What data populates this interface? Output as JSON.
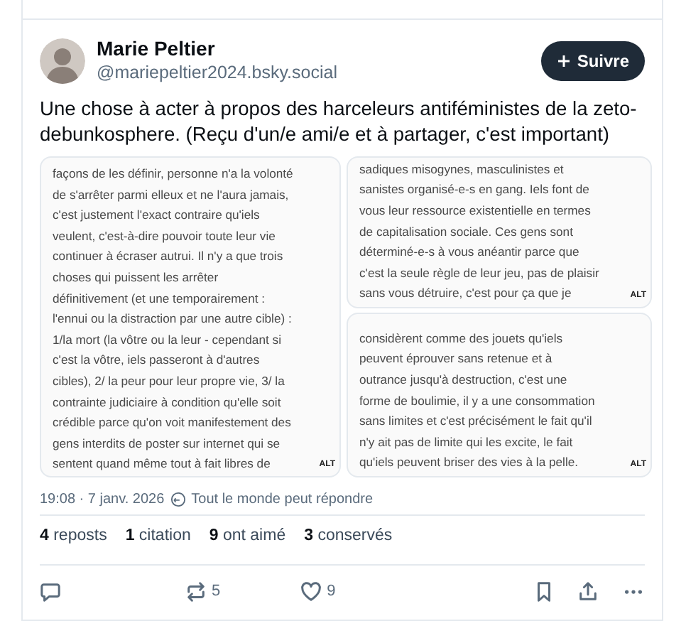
{
  "author": {
    "name": "Marie Peltier",
    "handle": "@mariepeltier2024.bsky.social"
  },
  "follow_button": {
    "label": "Suivre"
  },
  "text": "Une chose à acter à propos des harceleurs antiféministes de la zeto-debunkosphere. (Reçu d'un/e ami/e et à partager, c'est important)",
  "images": [
    {
      "lines": [
        "façons de les définir, personne n'a la volonté",
        "de s'arrêter parmi elleux et ne l'aura jamais,",
        "c'est justement l'exact contraire qu'iels",
        "veulent, c'est-à-dire pouvoir toute leur vie",
        "continuer à écraser autrui. Il n'y a que trois",
        "choses qui puissent les arrêter",
        "définitivement (et une temporairement :",
        "l'ennui ou la distraction par une autre cible) :",
        "1/la mort (la vôtre ou la leur - cependant si",
        "c'est la vôtre, iels passeront à d'autres",
        "cibles), 2/ la peur pour leur propre vie, 3/ la",
        "contrainte judiciaire à condition qu'elle soit",
        "crédible parce qu'on voit manifestement des",
        "gens interdits de poster sur internet qui se",
        "sentent quand même tout à fait libres de"
      ],
      "badge": "ALT"
    },
    {
      "lines": [
        "sadiques misogynes, masculinistes et",
        "sanistes organisé-e-s en gang. Iels font de",
        "vous leur ressource existentielle en termes",
        "de capitalisation sociale. Ces gens sont",
        "déterminé-e-s à vous anéantir parce que",
        "c'est la seule règle de leur jeu, pas de plaisir",
        "sans vous détruire, c'est pour ça que je"
      ],
      "badge": "ALT"
    },
    {
      "lines": [
        "considèrent comme des jouets qu'iels",
        "peuvent éprouver sans retenue et à",
        "outrance jusqu'à destruction, c'est une",
        "forme de boulimie, il y a une consommation",
        "sans limites et c'est précisément le fait qu'il",
        "n'y ait pas de limite qui les excite, le fait",
        "qu'iels peuvent briser des vies à la pelle."
      ],
      "badge": "ALT"
    }
  ],
  "timestamp": "19:08 · 7 janv. 2026",
  "reply_setting": "Tout le monde peut répondre",
  "stats": [
    {
      "count": "4",
      "label": "reposts"
    },
    {
      "count": "1",
      "label": "citation"
    },
    {
      "count": "9",
      "label": "ont aimé"
    },
    {
      "count": "3",
      "label": "conservés"
    }
  ],
  "actions": [
    {
      "kind": "reply"
    },
    {
      "kind": "repost",
      "count": "5"
    },
    {
      "kind": "like",
      "count": "9"
    },
    {
      "kind": "bookmark"
    },
    {
      "kind": "share"
    },
    {
      "kind": "more"
    }
  ]
}
